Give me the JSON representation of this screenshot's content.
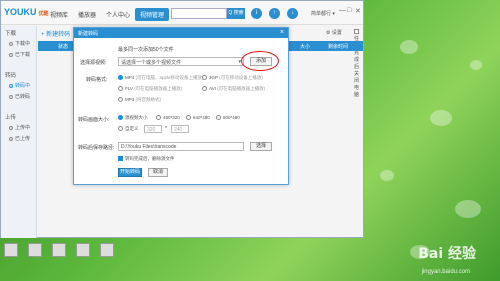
{
  "app": {
    "logo": "YOUKU",
    "logo_sub": "优酷",
    "tabs": [
      "视频库",
      "播放器",
      "个人中心",
      "视频管理"
    ],
    "active_tab": 3,
    "search_button": "Q 搜索",
    "user_label": "简单都行 ▾",
    "window_controls": [
      "—",
      "□",
      "✕"
    ]
  },
  "sidebar": {
    "sections": [
      {
        "title": "下载",
        "items": [
          "下载中",
          "已下载"
        ]
      },
      {
        "title": "转码",
        "items": [
          "转码中",
          "已转码"
        ]
      },
      {
        "title": "上传",
        "items": [
          "上传中",
          "已上传"
        ]
      }
    ],
    "active_item": "转码中"
  },
  "toolbar": {
    "new_task": "+ 新建转码",
    "settings": "⚙ 设置",
    "shutdown": "任务完成后关闭电脑"
  },
  "table_head": {
    "col1": "状态",
    "col2": "大小",
    "col3": "剩余时间"
  },
  "dialog": {
    "title": "新建转码",
    "limit_note": "最多同一次添加50个文件",
    "select_label": "选择源视频:",
    "select_placeholder": "请选择一个或多个视频文件",
    "add_button": "添加",
    "format_label": "转码格式:",
    "formats": [
      {
        "name": "MP4",
        "hint": "(可在电脑、apple移动设备上播放)",
        "on": true
      },
      {
        "name": "3GP",
        "hint": "(可在移动设备上播放)",
        "on": false
      },
      {
        "name": "FLV",
        "hint": "(可在电脑播放器上播放)",
        "on": false
      },
      {
        "name": "AVI",
        "hint": "(可在电脑播放器上播放)",
        "on": false
      },
      {
        "name": "MP3",
        "hint": "(纯音频格式)",
        "on": false
      }
    ],
    "size_label": "转码画面大小:",
    "sizes": [
      {
        "name": "源视频大小",
        "on": true
      },
      {
        "name": "480*320",
        "on": false
      },
      {
        "name": "640*480",
        "on": false
      },
      {
        "name": "800*480",
        "on": false
      }
    ],
    "custom_label": "自定义",
    "custom_w": "320",
    "custom_h": "240",
    "save_label": "转码后保存路径:",
    "save_path": "D:\\Youku Files\\transcode",
    "browse_button": "选择",
    "delete_after_label": "转码完成后，删除源文件",
    "start_button": "开始转码",
    "cancel_button": "取消"
  },
  "desktop": {
    "watermark": "Bai 经验",
    "watermark_url": "jingyan.baidu.com"
  }
}
